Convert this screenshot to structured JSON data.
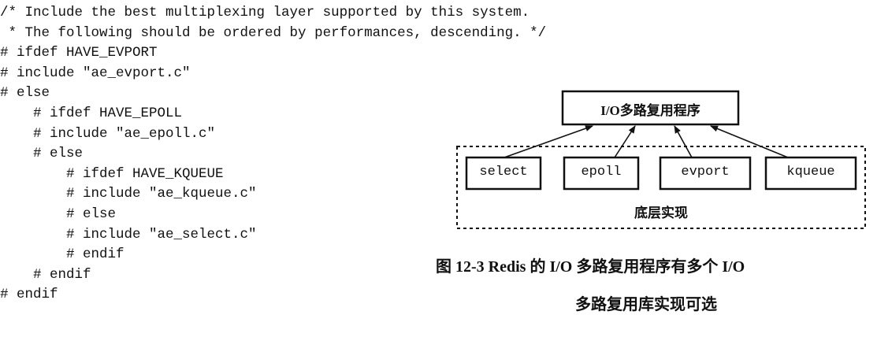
{
  "code": {
    "lines": [
      "/* Include the best multiplexing layer supported by this system.",
      " * The following should be ordered by performances, descending. */",
      "# ifdef HAVE_EVPORT",
      "# include \"ae_evport.c\"",
      "# else",
      "    # ifdef HAVE_EPOLL",
      "    # include \"ae_epoll.c\"",
      "    # else",
      "        # ifdef HAVE_KQUEUE",
      "        # include \"ae_kqueue.c\"",
      "        # else",
      "        # include \"ae_select.c\"",
      "        # endif",
      "    # endif",
      "# endif"
    ]
  },
  "diagram": {
    "top_box": "I/O多路复用程序",
    "boxes": [
      "select",
      "epoll",
      "evport",
      "kqueue"
    ],
    "group_label": "底层实现"
  },
  "caption": {
    "line1": "图 12-3   Redis 的 I/O 多路复用程序有多个 I/O",
    "line2": "多路复用库实现可选"
  }
}
